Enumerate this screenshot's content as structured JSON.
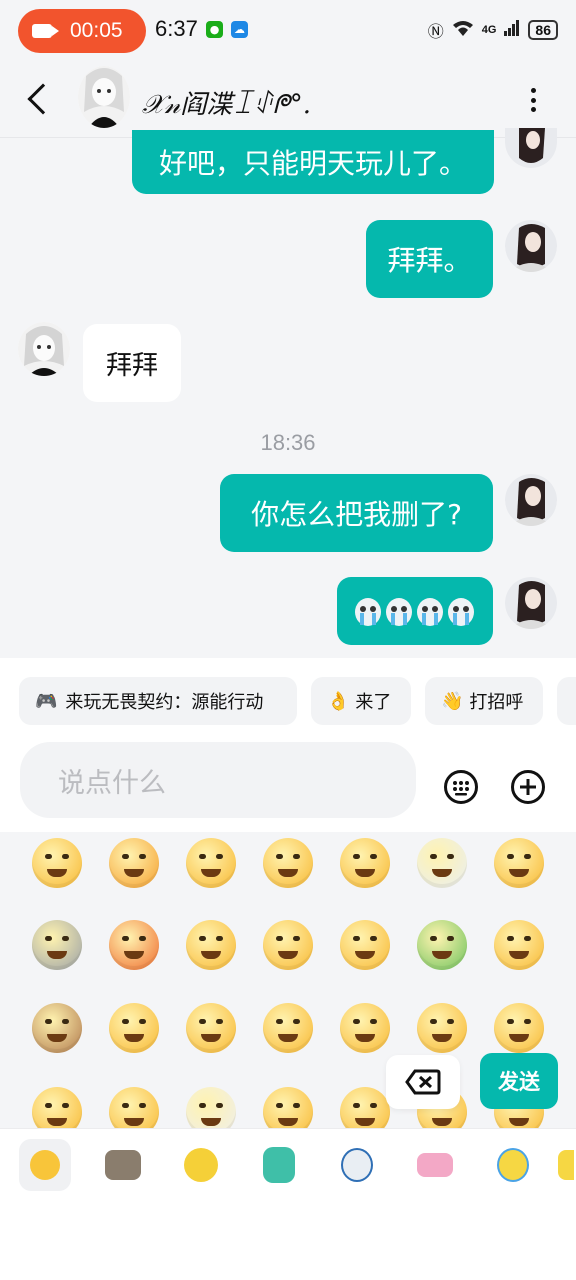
{
  "status_bar": {
    "recording_time": "00:05",
    "clock": "6:37",
    "network": "4G",
    "battery": "86"
  },
  "header": {
    "title": "𝒳𝓃阎渫ꀤꂑᖘ°."
  },
  "messages": [
    {
      "sender": "me",
      "text": "好吧，只能明天玩儿了。"
    },
    {
      "sender": "me",
      "text": "拜拜。"
    },
    {
      "sender": "other",
      "text": "拜拜"
    },
    {
      "type": "time",
      "text": "18:36"
    },
    {
      "sender": "me",
      "text": "你怎么把我删了?"
    },
    {
      "sender": "me",
      "sticker": "crying-seal-emoji x4"
    }
  ],
  "quick_replies": [
    {
      "icon": "gamepad-icon",
      "label": "来玩无畏契约：源能行动"
    },
    {
      "icon": "ok-hand-icon",
      "label": "来了"
    },
    {
      "icon": "waving-hand-icon",
      "label": "打招呼"
    }
  ],
  "input": {
    "placeholder": "说点什么"
  },
  "emoji_panel": {
    "send_label": "发送"
  },
  "colors": {
    "accent": "#05b8ad",
    "recording": "#f2542d"
  }
}
